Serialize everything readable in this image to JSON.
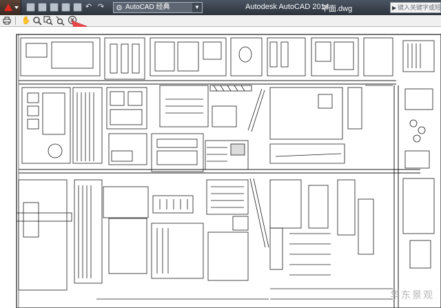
{
  "window": {
    "app_title": "Autodesk AutoCAD 2014",
    "file_title": "平面.dwg"
  },
  "workspace": {
    "selected": "AutoCAD 经典"
  },
  "help_search": {
    "placeholder": "键入关键字或短语"
  },
  "quick_access": {
    "buttons": [
      "new-icon",
      "open-icon",
      "save-icon",
      "save-as-icon",
      "print-icon",
      "undo-icon",
      "redo-icon"
    ]
  },
  "preview_toolbar": {
    "buttons": [
      "print-icon",
      "pan-hand-icon",
      "zoom-icon",
      "zoom-window-icon",
      "zoom-original-icon",
      "close-preview-icon"
    ]
  },
  "watermark": {
    "text": "华东景观"
  },
  "colors": {
    "titlebar": "#2c333c",
    "app_menu_accent": "#e0281e",
    "annotation_arrow": "#e8464a",
    "drawing_lines": "#1a1a1a"
  }
}
